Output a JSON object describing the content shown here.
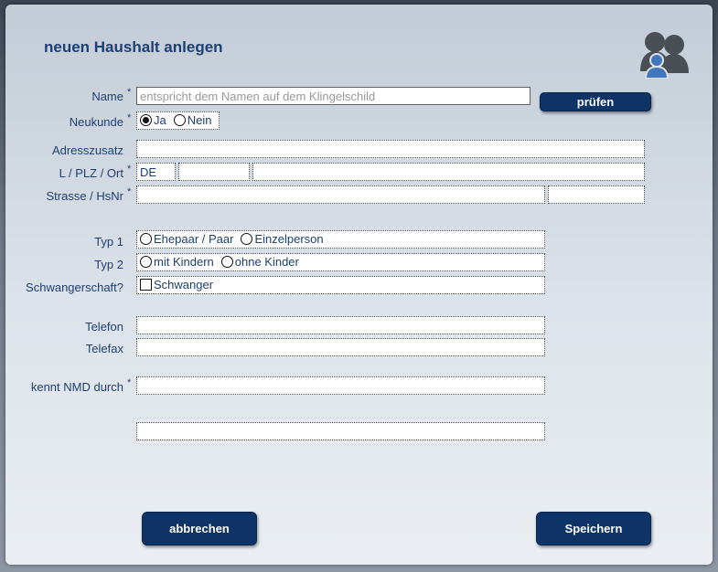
{
  "dialog": {
    "title": "neuen Haushalt anlegen",
    "icon": "users-group-icon",
    "check_label": "prüfen",
    "cancel_label": "abbrechen",
    "save_label": "Speichern"
  },
  "labels": {
    "name": "Name",
    "neukunde": "Neukunde",
    "adresszusatz": "Adresszusatz",
    "lplzort": "L / PLZ / Ort",
    "strasse": "Strasse / HsNr",
    "typ1": "Typ 1",
    "typ2": "Typ 2",
    "schwanger": "Schwangerschaft?",
    "telefon": "Telefon",
    "telefax": "Telefax",
    "kennt": "kennt NMD durch",
    "required_marker": "*"
  },
  "fields": {
    "name_placeholder": "entspricht dem Namen auf dem Klingelschild",
    "land_value": "DE"
  },
  "options": {
    "neukunde_ja": "Ja",
    "neukunde_nein": "Nein",
    "neukunde_selected": "Ja",
    "typ1_a": "Ehepaar / Paar",
    "typ1_b": "Einzelperson",
    "typ2_a": "mit Kindern",
    "typ2_b": "ohne Kinder",
    "schwanger": "Schwanger"
  },
  "colors": {
    "accent": "#1e3f73",
    "button": "#0e3467"
  }
}
